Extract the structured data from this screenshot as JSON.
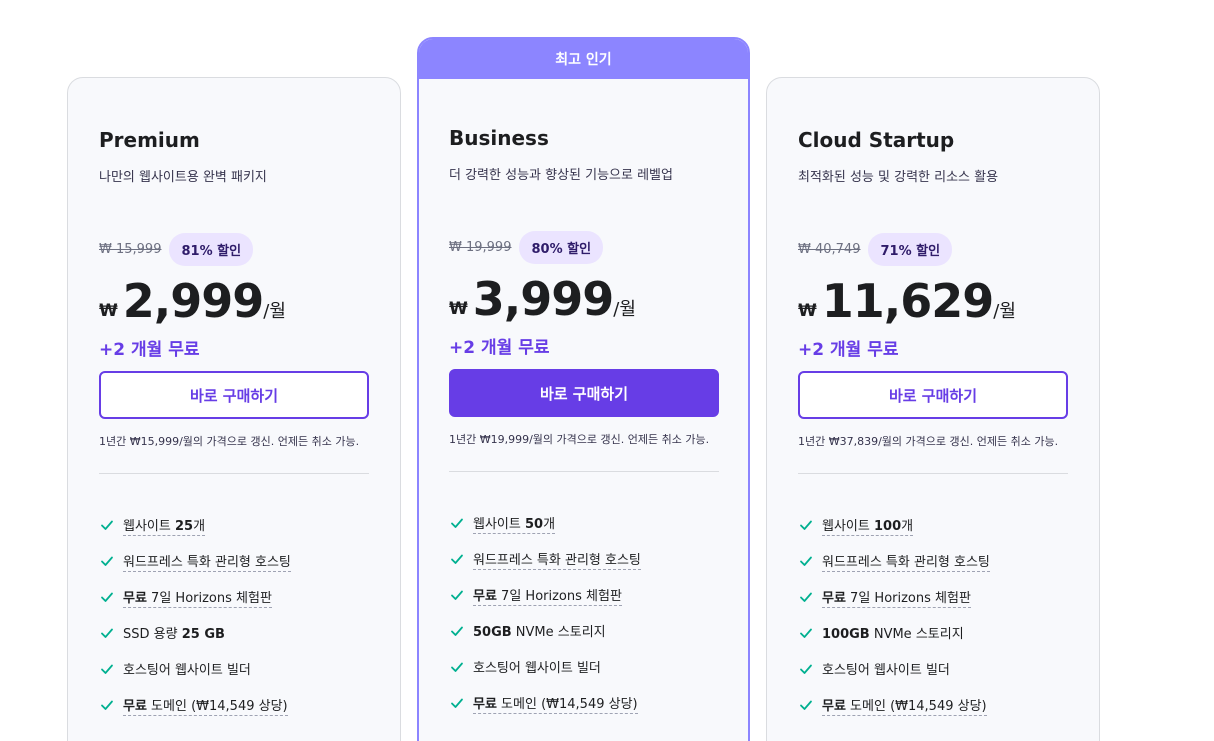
{
  "header": {
    "cut_text": ""
  },
  "plans": [
    {
      "name": "Premium",
      "desc": "나만의 웹사이트용 완벽 패키지",
      "old_price": "₩ 15,999",
      "discount": "81% 할인",
      "currency": "₩",
      "price": "2,999",
      "per": "/월",
      "bonus": "+2 개월 무료",
      "button": "바로 구매하기",
      "renew": "1년간 ₩15,999/월의 가격으로 갱신. 언제든 취소 가능.",
      "features": [
        {
          "pre": "웹사이트 ",
          "bold": "25",
          "post": "개"
        },
        {
          "pre": "워드프레스 특화 관리형 호스팅",
          "bold": "",
          "post": ""
        },
        {
          "pre": "",
          "bold": "무료",
          "post": " 7일 Horizons 체험판"
        },
        {
          "pre": "SSD 용량 ",
          "bold": "25 GB",
          "post": ""
        },
        {
          "pre": "호스팅어 웹사이트 빌더",
          "bold": "",
          "post": ""
        },
        {
          "pre": "",
          "bold": "무료",
          "post": " 도메인 (₩14,549 상당)"
        }
      ]
    },
    {
      "badge": "최고 인기",
      "name": "Business",
      "desc": "더 강력한 성능과 향상된 기능으로 레벨업",
      "old_price": "₩ 19,999",
      "discount": "80% 할인",
      "currency": "₩",
      "price": "3,999",
      "per": "/월",
      "bonus": "+2 개월 무료",
      "button": "바로 구매하기",
      "renew": "1년간 ₩19,999/월의 가격으로 갱신. 언제든 취소 가능.",
      "features": [
        {
          "pre": "웹사이트 ",
          "bold": "50",
          "post": "개"
        },
        {
          "pre": "워드프레스 특화 관리형 호스팅",
          "bold": "",
          "post": ""
        },
        {
          "pre": "",
          "bold": "무료",
          "post": " 7일 Horizons 체험판"
        },
        {
          "pre": "",
          "bold": "50GB",
          "post": " NVMe 스토리지"
        },
        {
          "pre": "호스팅어 웹사이트 빌더",
          "bold": "",
          "post": ""
        },
        {
          "pre": "",
          "bold": "무료",
          "post": " 도메인 (₩14,549 상당)"
        }
      ]
    },
    {
      "name": "Cloud Startup",
      "desc": "최적화된 성능 및 강력한 리소스 활용",
      "old_price": "₩ 40,749",
      "discount": "71% 할인",
      "currency": "₩",
      "price": "11,629",
      "per": "/월",
      "bonus": "+2 개월 무료",
      "button": "바로 구매하기",
      "renew": "1년간 ₩37,839/월의 가격으로 갱신. 언제든 취소 가능.",
      "features": [
        {
          "pre": "웹사이트 ",
          "bold": "100",
          "post": "개"
        },
        {
          "pre": "워드프레스 특화 관리형 호스팅",
          "bold": "",
          "post": ""
        },
        {
          "pre": "",
          "bold": "무료",
          "post": " 7일 Horizons 체험판"
        },
        {
          "pre": "",
          "bold": "100GB",
          "post": " NVMe 스토리지"
        },
        {
          "pre": "호스팅어 웹사이트 빌더",
          "bold": "",
          "post": ""
        },
        {
          "pre": "",
          "bold": "무료",
          "post": " 도메인 (₩14,549 상당)"
        }
      ]
    }
  ],
  "colors": {
    "accent": "#673de6",
    "badge": "#8c85ff",
    "discount_bg": "#ebe4ff",
    "check": "#00b090"
  },
  "icons": {
    "feature": "check-icon"
  }
}
